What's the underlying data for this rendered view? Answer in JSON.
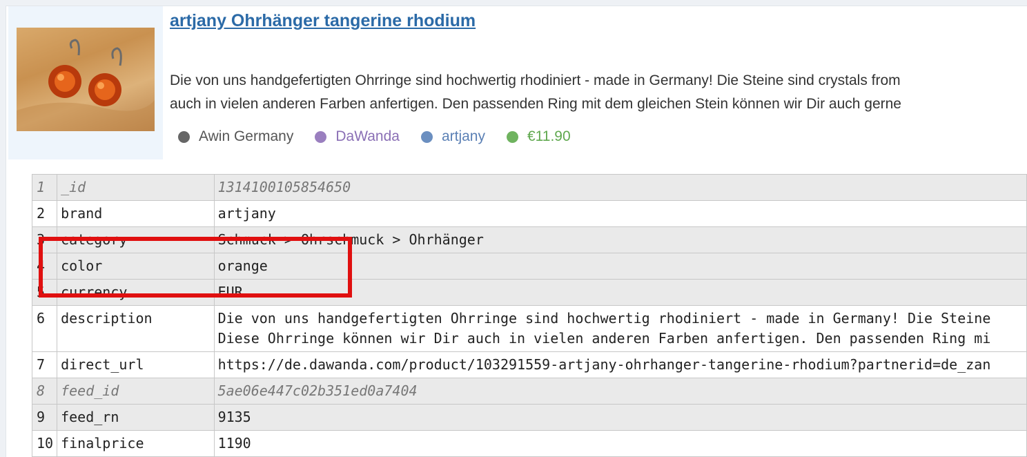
{
  "product": {
    "title": "artjany Ohrhänger tangerine rhodium",
    "description_lines": [
      "Die von uns handgefertigten Ohrringe sind hochwertig rhodiniert - made in Germany! Die Steine sind crystals from",
      "auch in vielen anderen Farben anfertigen. Den passenden Ring mit dem gleichen Stein können wir Dir auch gerne"
    ],
    "meta": [
      {
        "label": "Awin Germany",
        "color": "#666666",
        "text_color": "#555555"
      },
      {
        "label": "DaWanda",
        "color": "#9a7fbf",
        "text_color": "#8a6fb5"
      },
      {
        "label": "artjany",
        "color": "#6b8fc0",
        "text_color": "#5b80b5"
      },
      {
        "label": "€11.90",
        "color": "#6fb35f",
        "text_color": "#5fa84e"
      }
    ]
  },
  "table": {
    "rows": [
      {
        "num": "1",
        "key": "_id",
        "val": "1314100105854650"
      },
      {
        "num": "2",
        "key": "brand",
        "val": "artjany"
      },
      {
        "num": "3",
        "key": "category",
        "val": "Schmuck > Ohrschmuck > Ohrhänger"
      },
      {
        "num": "4",
        "key": "color",
        "val": "orange"
      },
      {
        "num": "5",
        "key": "currency",
        "val": "EUR"
      },
      {
        "num": "6",
        "key": "description",
        "val": "Die von uns handgefertigten Ohrringe sind hochwertig rhodiniert - made in Germany! Die Steine",
        "val2": "Diese Ohrringe können wir Dir auch in vielen anderen Farben anfertigen. Den passenden Ring mi"
      },
      {
        "num": "7",
        "key": "direct_url",
        "val": "https://de.dawanda.com/product/103291559-artjany-ohrhanger-tangerine-rhodium?partnerid=de_zan"
      },
      {
        "num": "8",
        "key": "feed_id",
        "val": "5ae06e447c02b351ed0a7404"
      },
      {
        "num": "9",
        "key": "feed_rn",
        "val": "9135"
      },
      {
        "num": "10",
        "key": "finalprice",
        "val": "1190"
      }
    ]
  }
}
